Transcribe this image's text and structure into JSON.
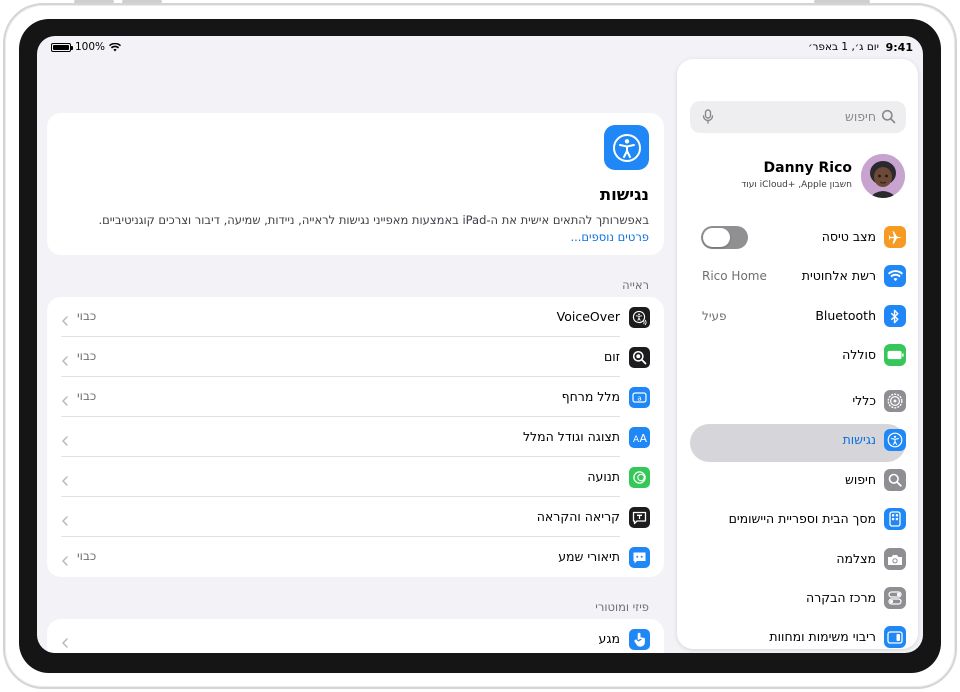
{
  "status": {
    "time": "9:41",
    "date": "יום ג׳, 1 באפר׳",
    "battery": "100%"
  },
  "sidebar": {
    "search_placeholder": "חיפוש",
    "profile": {
      "name": "Danny Rico",
      "subtitle": "חשבון Apple, ‏iCloud+‎ ועוד"
    },
    "items": [
      {
        "label": "מצב טיסה",
        "icon": "airplane-icon",
        "color": "#f59a23",
        "control": "toggle",
        "toggle_on": false
      },
      {
        "label": "רשת אלחוטית",
        "icon": "wifi-icon",
        "color": "#1f88f6",
        "value": "Rico Home"
      },
      {
        "label": "Bluetooth",
        "icon": "bluetooth-icon",
        "color": "#1f88f6",
        "value": "פעיל"
      },
      {
        "label": "סוללה",
        "icon": "battery-icon",
        "color": "#35c759"
      },
      {
        "label": "כללי",
        "icon": "gear-icon",
        "color": "#8e8e93"
      },
      {
        "label": "נגישות",
        "icon": "accessibility-icon",
        "color": "#1f88f6",
        "selected": true
      },
      {
        "label": "חיפוש",
        "icon": "search-icon",
        "color": "#8e8e93"
      },
      {
        "label": "מסך הבית וספריית היישומים",
        "icon": "home-screen-icon",
        "color": "#1f88f6"
      },
      {
        "label": "מצלמה",
        "icon": "camera-icon",
        "color": "#8e8e93"
      },
      {
        "label": "מרכז הבקרה",
        "icon": "control-center-icon",
        "color": "#8e8e93"
      },
      {
        "label": "ריבוי משימות ומחוות",
        "icon": "multitasking-icon",
        "color": "#1f88f6"
      }
    ]
  },
  "main": {
    "header": {
      "title": "נגישות",
      "description": "באפשרותך להתאים אישית את ה‑iPad באמצעות מאפייני נגישות לראייה, ניידות, שמיעה, דיבור וצרכים קוגניטיביים.",
      "more_link": "פרטים נוספים..."
    },
    "section_vision": "ראייה",
    "vision_items": [
      {
        "label": "VoiceOver",
        "value": "כבוי",
        "icon": "voiceover-icon",
        "color": "#1c1c1e"
      },
      {
        "label": "זום",
        "value": "כבוי",
        "icon": "zoom-icon",
        "color": "#1c1c1e"
      },
      {
        "label": "מלל מרחף",
        "value": "כבוי",
        "icon": "hover-text-icon",
        "color": "#1f88f6"
      },
      {
        "label": "תצוגה וגודל המלל",
        "value": "",
        "icon": "text-size-icon",
        "color": "#1f88f6"
      },
      {
        "label": "תנועה",
        "value": "",
        "icon": "motion-icon",
        "color": "#35c759"
      },
      {
        "label": "קריאה והקראה",
        "value": "",
        "icon": "spoken-content-icon",
        "color": "#1c1c1e"
      },
      {
        "label": "תיאורי שמע",
        "value": "כבוי",
        "icon": "audio-descriptions-icon",
        "color": "#1f88f6"
      }
    ],
    "section_physical": "פיזי ומוטורי",
    "physical_items": [
      {
        "label": "מגע",
        "value": "",
        "icon": "touch-icon",
        "color": "#1f88f6"
      }
    ]
  }
}
